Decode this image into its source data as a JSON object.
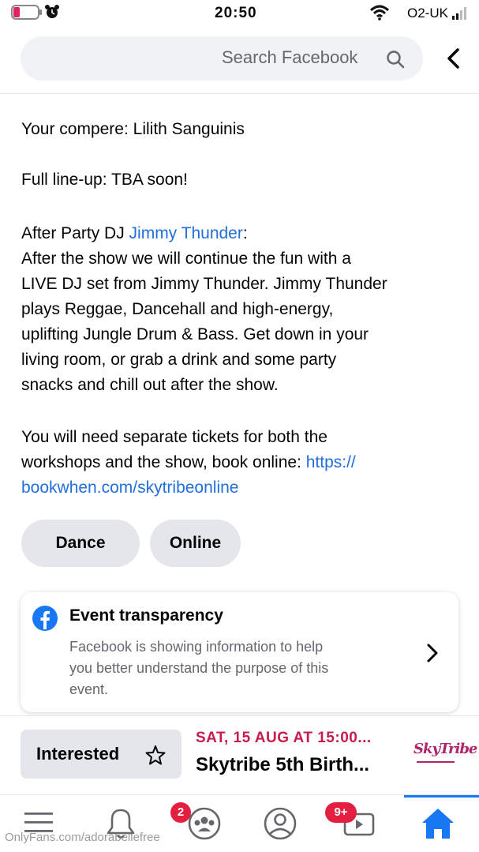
{
  "status_bar": {
    "time": "20:50",
    "carrier": "O2-UK"
  },
  "header": {
    "search_placeholder": "Search Facebook"
  },
  "content": {
    "compere": "Your compere: Lilith Sanguinis",
    "lineup": "Full line-up: TBA soon!",
    "after_party_prefix": "After Party DJ ",
    "after_party_link": "Jimmy Thunder",
    "after_party_suffix": ":",
    "after_party_lines": [
      "After the show we will continue the fun with a",
      "LIVE DJ set from Jimmy Thunder. Jimmy Thunder",
      "plays Reggae, Dancehall and high-energy,",
      "uplifting Jungle Drum & Bass. Get down in your",
      "living room, or grab a drink and some party",
      "snacks and chill out after the show."
    ],
    "tickets_line1": "You will need separate tickets for both the",
    "tickets_line2_text": "workshops and the show, book online: ",
    "tickets_line2_link": "https://",
    "tickets_line3_link": "bookwhen.com/skytribeonline"
  },
  "tags": [
    "Dance",
    "Online"
  ],
  "transparency_card": {
    "title": "Event transparency",
    "lines": [
      "Facebook is showing information to help",
      "you better understand the purpose of this",
      "event."
    ]
  },
  "event_footer": {
    "date": "SAT, 15 AUG AT 15:00...",
    "title": "Skytribe 5th Birth...",
    "interested_label": "Interested",
    "logo_text": "SkyTribe"
  },
  "bottom_nav": {
    "notifications_badge_video": "9+",
    "notifications_badge_groups": "2",
    "watermark": "OnlyFans.com/adorabellefree"
  }
}
